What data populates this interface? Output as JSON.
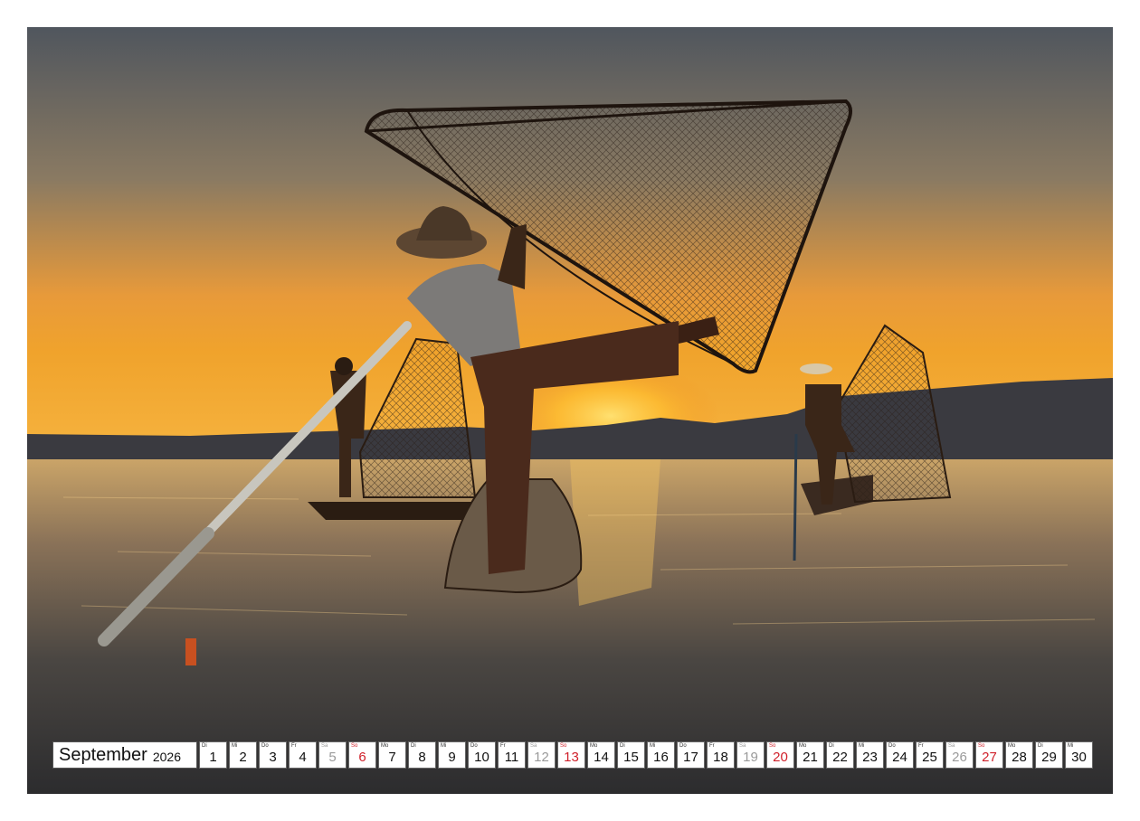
{
  "calendar": {
    "month": "September",
    "year": "2026",
    "days": [
      {
        "wd": "Di",
        "n": "1",
        "type": "weekday"
      },
      {
        "wd": "Mi",
        "n": "2",
        "type": "weekday"
      },
      {
        "wd": "Do",
        "n": "3",
        "type": "weekday"
      },
      {
        "wd": "Fr",
        "n": "4",
        "type": "weekday"
      },
      {
        "wd": "Sa",
        "n": "5",
        "type": "sat"
      },
      {
        "wd": "So",
        "n": "6",
        "type": "sun"
      },
      {
        "wd": "Mo",
        "n": "7",
        "type": "weekday"
      },
      {
        "wd": "Di",
        "n": "8",
        "type": "weekday"
      },
      {
        "wd": "Mi",
        "n": "9",
        "type": "weekday"
      },
      {
        "wd": "Do",
        "n": "10",
        "type": "weekday"
      },
      {
        "wd": "Fr",
        "n": "11",
        "type": "weekday"
      },
      {
        "wd": "Sa",
        "n": "12",
        "type": "sat"
      },
      {
        "wd": "So",
        "n": "13",
        "type": "sun"
      },
      {
        "wd": "Mo",
        "n": "14",
        "type": "weekday"
      },
      {
        "wd": "Di",
        "n": "15",
        "type": "weekday"
      },
      {
        "wd": "Mi",
        "n": "16",
        "type": "weekday"
      },
      {
        "wd": "Do",
        "n": "17",
        "type": "weekday"
      },
      {
        "wd": "Fr",
        "n": "18",
        "type": "weekday"
      },
      {
        "wd": "Sa",
        "n": "19",
        "type": "sat"
      },
      {
        "wd": "So",
        "n": "20",
        "type": "sun"
      },
      {
        "wd": "Mo",
        "n": "21",
        "type": "weekday"
      },
      {
        "wd": "Di",
        "n": "22",
        "type": "weekday"
      },
      {
        "wd": "Mi",
        "n": "23",
        "type": "weekday"
      },
      {
        "wd": "Do",
        "n": "24",
        "type": "weekday"
      },
      {
        "wd": "Fr",
        "n": "25",
        "type": "weekday"
      },
      {
        "wd": "Sa",
        "n": "26",
        "type": "sat"
      },
      {
        "wd": "So",
        "n": "27",
        "type": "sun"
      },
      {
        "wd": "Mo",
        "n": "28",
        "type": "weekday"
      },
      {
        "wd": "Di",
        "n": "29",
        "type": "weekday"
      },
      {
        "wd": "Mi",
        "n": "30",
        "type": "weekday"
      }
    ]
  },
  "colors": {
    "sky_top": "#5a5f66",
    "sky_horizon": "#f0a030",
    "silhouette": "#2a1a10",
    "sunday_red": "#d0202a",
    "saturday_gray": "#9a9a9a"
  }
}
